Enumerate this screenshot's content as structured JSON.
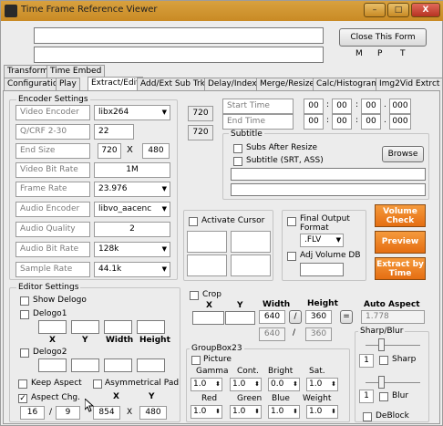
{
  "window": {
    "title": "Time Frame Reference Viewer",
    "min_label": "–",
    "max_label": "□",
    "close_label": "X"
  },
  "top": {
    "close_form_label": "Close This Form",
    "m": "M",
    "p": "P",
    "t": "T"
  },
  "tabs_row1": [
    "Transform",
    "Time Embed"
  ],
  "tabs_row2": [
    "Configuration",
    "Play",
    "Extract/Edit",
    "Add/Ext Sub Trk",
    "Delay/Index",
    "Merge/Resize",
    "Calc/Histogram",
    "Img2Vid Extrct"
  ],
  "encoder": {
    "title": "Encoder Settings",
    "video_encoder": {
      "label": "Video Encoder",
      "value": "libx264"
    },
    "qcrf": {
      "label": "Q/CRF  2-30",
      "value": "22"
    },
    "end_size": {
      "label": "End Size",
      "w": "720",
      "x": "X",
      "h": "480"
    },
    "video_bitrate": {
      "label": "Video Bit Rate",
      "value": "1M"
    },
    "frame_rate": {
      "label": "Frame Rate",
      "value": "23.976"
    },
    "audio_encoder": {
      "label": "Audio Encoder",
      "value": "libvo_aacenc"
    },
    "audio_quality": {
      "label": "Audio Quality",
      "value": "2"
    },
    "audio_bitrate": {
      "label": "Audio Bit Rate",
      "value": "128k"
    },
    "sample_rate": {
      "label": "Sample Rate",
      "value": "44.1k"
    }
  },
  "size_labels": {
    "top": "720",
    "bottom": "720"
  },
  "time": {
    "start_label": "Start Time",
    "end_label": "End Time",
    "start": [
      "00",
      "00",
      "00",
      "000"
    ],
    "end": [
      "00",
      "00",
      "00",
      "000"
    ],
    "sep1": ":",
    "sep2": ":",
    "sep3": "."
  },
  "subtitle": {
    "title": "Subtitle",
    "subs_after_resize": "Subs After Resize",
    "subtitle_srt": "Subtitle (SRT, ASS)",
    "browse": "Browse"
  },
  "activate_cursor": "Activate Cursor",
  "final_output": {
    "label": "Final Output Format",
    "value": ".FLV",
    "adj_volume": "Adj Volume DB"
  },
  "actions": {
    "volume_check": "Volume Check",
    "preview": "Preview",
    "extract": "Extract by Time"
  },
  "editor": {
    "title": "Editor Settings",
    "show_delogo": "Show Delogo",
    "delogo1": "Delogo1",
    "delogo2": "Delogo2",
    "cols": [
      "X",
      "Y",
      "Width",
      "Height"
    ],
    "keep_aspect": "Keep Aspect",
    "asym_pad": "Asymmetrical Pad",
    "aspect_chg": "Aspect Chg.",
    "pad_x": "X",
    "pad_y": "Y",
    "aspect_a": "16",
    "aspect_sep": "/",
    "aspect_b": "9",
    "res_w": "854",
    "res_x": "X",
    "res_h": "480"
  },
  "crop": {
    "label": "Crop",
    "cols": [
      "X",
      "Y",
      "Width",
      "Height"
    ],
    "width": "640",
    "slash": "/",
    "height": "360",
    "width2": "640",
    "height2": "360",
    "equals": "=",
    "auto_aspect_label": "Auto Aspect",
    "auto_aspect": "1.778"
  },
  "groupbox23": {
    "title": "GroupBox23",
    "picture": "Picture",
    "row1_labels": [
      "Gamma",
      "Cont.",
      "Bright",
      "Sat."
    ],
    "row1_values": [
      "1.0",
      "1.0",
      "0.0",
      "1.0"
    ],
    "row2_labels": [
      "Red",
      "Green",
      "Blue",
      "Weight"
    ],
    "row2_values": [
      "1.0",
      "1.0",
      "1.0",
      "1.0"
    ]
  },
  "sharp": {
    "title": "Sharp/Blur",
    "sharp": "Sharp",
    "blur": "Blur",
    "sharp_val": "1",
    "blur_val": "1",
    "deblock": "DeBlock"
  },
  "checkmark": "✓"
}
